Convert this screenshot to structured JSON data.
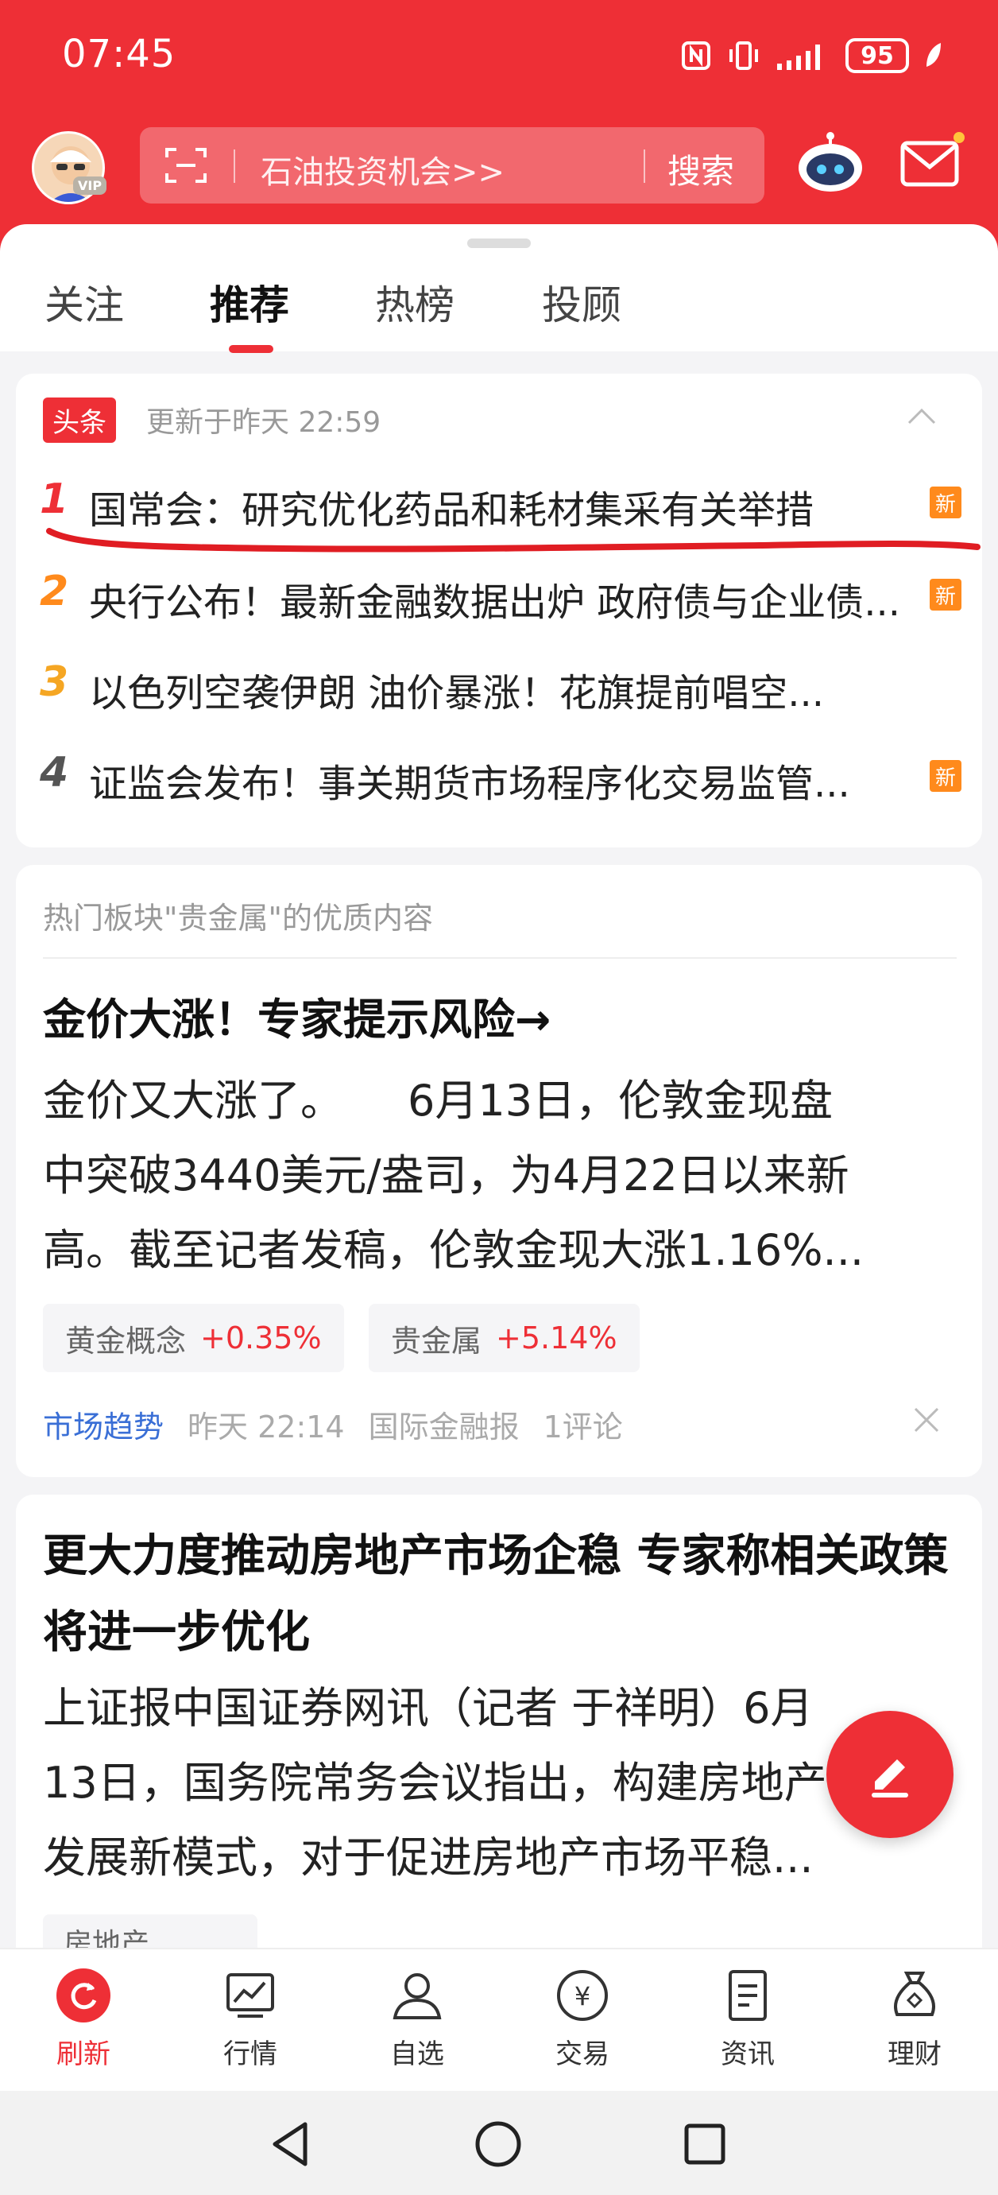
{
  "status_bar": {
    "time": "07:45",
    "battery": "95"
  },
  "header": {
    "search_placeholder": "石油投资机会>>",
    "search_button": "搜索",
    "vip": "VIP"
  },
  "tabs": [
    "关注",
    "推荐",
    "热榜",
    "投顾"
  ],
  "headlines": {
    "tag": "头条",
    "updated": "更新于昨天 22:59",
    "items": [
      {
        "num": "1",
        "title": "国常会：研究优化药品和耗材集采有关举措",
        "new": "新",
        "color": "#ee2f36"
      },
      {
        "num": "2",
        "title": "央行公布！最新金融数据出炉 政府债与企业债...",
        "new": "新",
        "color": "#ff8a1c"
      },
      {
        "num": "3",
        "title": "以色列空袭伊朗 油价暴涨！花旗提前唱空...",
        "new": "",
        "color": "#f5a623"
      },
      {
        "num": "4",
        "title": "证监会发布！事关期货市场程序化交易监管...",
        "new": "新",
        "color": "#555555"
      }
    ]
  },
  "article1": {
    "section_title": "热门板块\"贵金属\"的优质内容",
    "title": "金价大涨！专家提示风险→",
    "lines": [
      "金价又大涨了。　　6月13日，伦敦金现盘",
      "中突破3440美元/盎司，为4月22日以来新",
      "高。截至记者发稿，伦敦金现大涨1.16%..."
    ],
    "chips": [
      {
        "name": "黄金概念",
        "value": "+0.35%"
      },
      {
        "name": "贵金属",
        "value": "+5.14%"
      }
    ],
    "meta": {
      "source_tag": "市场趋势",
      "time": "昨天 22:14",
      "source": "国际金融报",
      "comments": "1评论"
    }
  },
  "article2": {
    "title": "更大力度推动房地产市场企稳 专家称相关政策将进一步优化",
    "lines": [
      "上证报中国证券网讯（记者 于祥明）6月",
      "13日，国务院常务会议指出，构建房地产",
      "发展新模式，对于促进房地产市场平稳..."
    ],
    "chip": "房地产　"
  },
  "bottom_nav": [
    "刷新",
    "行情",
    "自选",
    "交易",
    "资讯",
    "理财"
  ],
  "colors": {
    "brand_red": "#ee2f36",
    "new_badge": "#ff8a1c",
    "link_blue": "#3a6fd6"
  }
}
